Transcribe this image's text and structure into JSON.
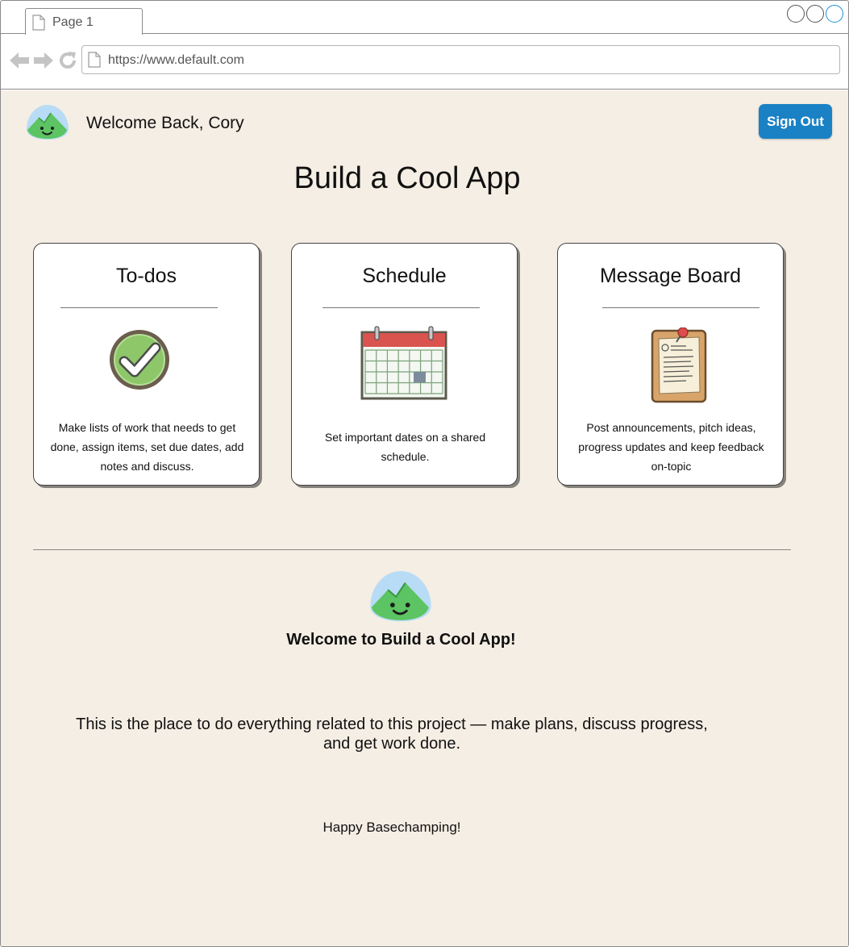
{
  "browser": {
    "tab_title": "Page 1",
    "url": "https://www.default.com"
  },
  "header": {
    "welcome_text": "Welcome Back, Cory",
    "sign_out_label": "Sign Out"
  },
  "project": {
    "title": "Build a Cool App"
  },
  "cards": [
    {
      "title": "To-dos",
      "icon": "checkmark-icon",
      "description": "Make lists of work that needs to get done, assign items, set due dates, add notes and discuss."
    },
    {
      "title": "Schedule",
      "icon": "calendar-icon",
      "description": "Set important dates on a shared schedule."
    },
    {
      "title": "Message Board",
      "icon": "message-board-icon",
      "description": "Post announcements, pitch ideas, progress updates and keep feedback on-topic"
    }
  ],
  "welcome": {
    "heading": "Welcome to Build a Cool App!",
    "body": "This is the place to do everything related to this project — make plans, discuss progress, and get work done.",
    "signoff": "Happy Basechamping!"
  },
  "colors": {
    "page_background": "#f5eee4",
    "sign_out_button": "#1a82c4",
    "logo_green": "#5cc462",
    "logo_blue": "#b8dcf5"
  }
}
